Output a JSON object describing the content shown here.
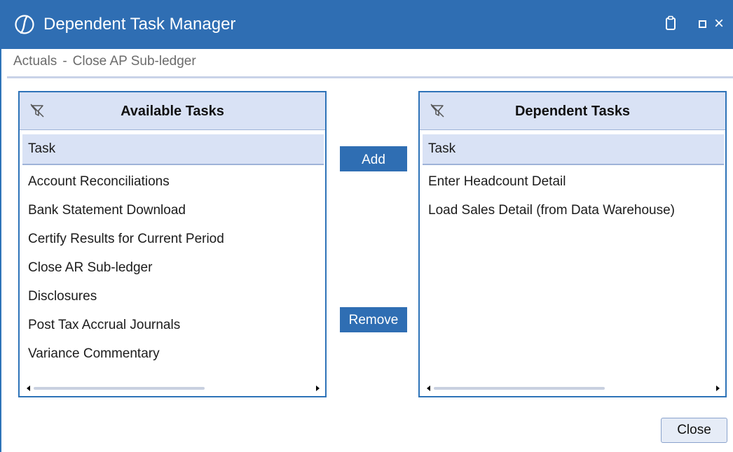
{
  "window": {
    "title": "Dependent Task Manager",
    "logo_icon": "onestream-logo-icon",
    "controls": [
      "clipboard-icon",
      "maximize-icon",
      "close-icon"
    ],
    "close_glyph": "×"
  },
  "breadcrumb": {
    "parent": "Actuals",
    "separator": "-",
    "current": "Close AP Sub-ledger"
  },
  "available": {
    "title": "Available Tasks",
    "filter_icon": "filter-off-icon",
    "column": "Task",
    "rows": [
      "Account Reconciliations",
      "Bank Statement Download",
      "Certify Results for Current Period",
      "Close AR Sub-ledger",
      "Disclosures",
      "Post Tax Accrual Journals",
      "Variance Commentary"
    ]
  },
  "dependent": {
    "title": "Dependent Tasks",
    "filter_icon": "filter-off-icon",
    "column": "Task",
    "rows": [
      "Enter Headcount Detail",
      "Load Sales Detail (from Data Warehouse)"
    ]
  },
  "buttons": {
    "add": "Add",
    "remove": "Remove",
    "close": "Close"
  },
  "colors": {
    "titlebar": "#2f6eb3",
    "panel_border": "#2e73b8",
    "header_fill": "#d9e2f5",
    "breadcrumb_text": "#6b6b6b"
  }
}
